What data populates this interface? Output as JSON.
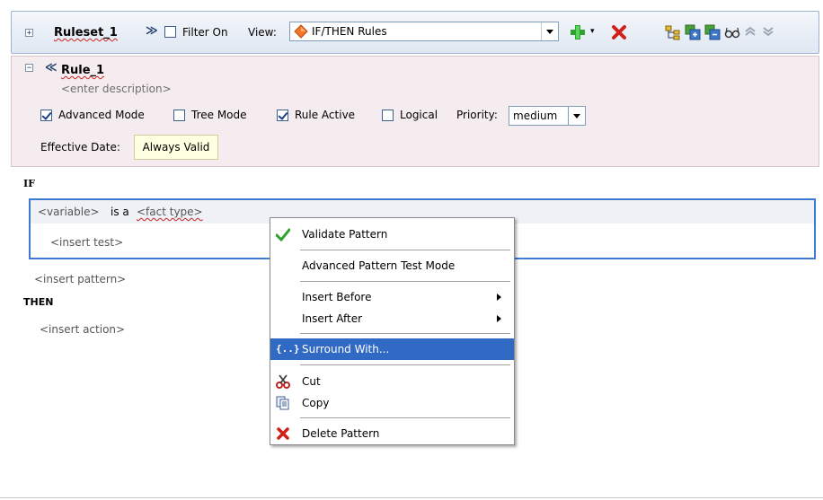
{
  "toolbar": {
    "expander_symbol": "⊞",
    "ruleset_name": "Ruleset_1",
    "collapse_symbol": "≫",
    "filter_label": "Filter On",
    "filter_checked": false,
    "view_label": "View:",
    "view_value": "IF/THEN Rules"
  },
  "rule": {
    "expander_symbol": "⊟",
    "name": "Rule_1",
    "description_placeholder": "<enter description>",
    "advanced_mode_label": "Advanced Mode",
    "advanced_mode_checked": true,
    "tree_mode_label": "Tree Mode",
    "tree_mode_checked": false,
    "rule_active_label": "Rule Active",
    "rule_active_checked": true,
    "logical_label": "Logical",
    "logical_checked": false,
    "priority_label": "Priority:",
    "priority_value": "medium",
    "effective_date_label": "Effective Date:",
    "effective_date_value": "Always Valid"
  },
  "if_section": {
    "label": "IF",
    "pattern_variable": "<variable>",
    "pattern_is_a": "is a",
    "pattern_fact_type": "<fact type>",
    "insert_test": "<insert test>",
    "insert_pattern": "<insert pattern>"
  },
  "then_section": {
    "label": "THEN",
    "insert_action": "<insert action>"
  },
  "context_menu": {
    "validate_pattern": "Validate Pattern",
    "advanced_pattern_test_mode": "Advanced Pattern Test Mode",
    "insert_before": "Insert Before",
    "insert_after": "Insert After",
    "surround_with": "Surround With...",
    "cut": "Cut",
    "copy": "Copy",
    "delete_pattern": "Delete Pattern",
    "highlight_color": "#316ac5"
  },
  "icons": {
    "add": "plus-icon",
    "delete": "red-x-icon",
    "toolbar_right": [
      "tree-icon",
      "expand-all-icon",
      "collapse-all-icon",
      "glasses-icon",
      "chevron-up-icon",
      "chevron-down-icon"
    ]
  }
}
